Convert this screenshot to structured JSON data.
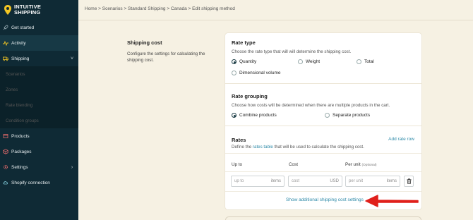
{
  "brand": {
    "name_line1": "INTUITIVE",
    "name_line2": "SHIPPING"
  },
  "colors": {
    "sidebar": "#0f2a35",
    "accent": "#f3c623",
    "link": "#2e8aa8",
    "arrow": "#e0201b",
    "background": "#f6f1e3"
  },
  "sidebar": {
    "items": [
      {
        "label": "Get started",
        "icon": "rocket-icon"
      },
      {
        "label": "Activity",
        "icon": "activity-icon"
      },
      {
        "label": "Shipping",
        "icon": "truck-icon",
        "chevron": "˅"
      },
      {
        "label": "Scenarios"
      },
      {
        "label": "Zones"
      },
      {
        "label": "Rate blending"
      },
      {
        "label": "Condition groups"
      },
      {
        "label": "Products",
        "icon": "box-icon"
      },
      {
        "label": "Packages",
        "icon": "package-icon"
      },
      {
        "label": "Settings",
        "icon": "gear-icon",
        "chevron": "›"
      },
      {
        "label": "Shopify connection",
        "icon": "cloud-icon"
      }
    ]
  },
  "breadcrumb": "Home > Scenarios > Standard Shipping > Canada > Edit shipping method",
  "section": {
    "title": "Shipping cost",
    "description": "Configure the settings for calculating the shipping cost."
  },
  "rate_type": {
    "title": "Rate type",
    "subtitle": "Choose the rate type that will will determine the shipping cost.",
    "options": [
      {
        "label": "Quantity",
        "selected": true
      },
      {
        "label": "Weight",
        "selected": false
      },
      {
        "label": "Total",
        "selected": false
      },
      {
        "label": "Dimensional volume",
        "selected": false
      }
    ]
  },
  "rate_grouping": {
    "title": "Rate grouping",
    "subtitle": "Choose how costs will be determined when there are multiple products in the cart.",
    "options": [
      {
        "label": "Combine products",
        "selected": true
      },
      {
        "label": "Separate products",
        "selected": false
      }
    ]
  },
  "rates": {
    "title": "Rates",
    "add_label": "Add rate row",
    "desc_pre": "Define the ",
    "desc_link": "rates table",
    "desc_post": " that will be used to calculate the shipping cost.",
    "columns": {
      "up_to": "Up to",
      "cost": "Cost",
      "per_unit": "Per unit",
      "per_unit_note": "(Optional)"
    },
    "row": {
      "up_to_placeholder": "up to",
      "up_to_suffix": "items",
      "cost_placeholder": "cost",
      "cost_suffix": "USD",
      "per_unit_placeholder": "per unit",
      "per_unit_suffix": "items"
    },
    "additional_link": "Show additional shipping cost settings"
  }
}
